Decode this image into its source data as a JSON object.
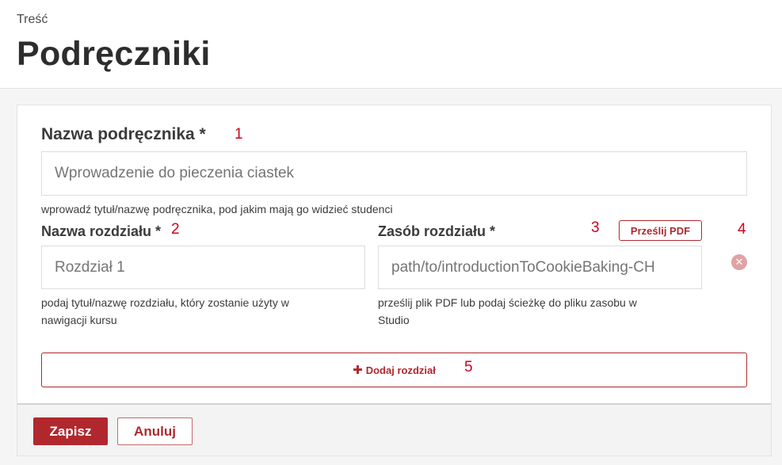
{
  "header": {
    "breadcrumb": "Treść",
    "title": "Podręczniki"
  },
  "form": {
    "textbook_name": {
      "label": "Nazwa podręcznika *",
      "marker": "1",
      "placeholder": "Wprowadzenie do pieczenia ciastek",
      "help": "wprowadź tytuł/nazwę podręcznika, pod jakim mają go widzieć studenci"
    },
    "chapter_name": {
      "label": "Nazwa rozdziału *",
      "marker": "2",
      "placeholder": "Rozdział 1",
      "help_line1": "podaj tytuł/nazwę rozdziału, który zostanie użyty w",
      "help_line2": "nawigacji kursu"
    },
    "chapter_asset": {
      "label": "Zasób rozdziału *",
      "marker": "3",
      "upload_label": "Prześlij PDF",
      "placeholder": "path/to/introductionToCookieBaking-CH",
      "help_line1": "prześlij plik PDF lub podaj ścieżkę do pliku zasobu w",
      "help_line2": "Studio"
    },
    "remove_marker": "4",
    "remove_icon": "close-circle-icon",
    "add_chapter": {
      "icon": "plus-icon",
      "label": "Dodaj rozdział",
      "marker": "5"
    }
  },
  "footer": {
    "save_label": "Zapisz",
    "cancel_label": "Anuluj"
  },
  "colors": {
    "accent": "#b0282e",
    "marker": "#d0021b"
  }
}
